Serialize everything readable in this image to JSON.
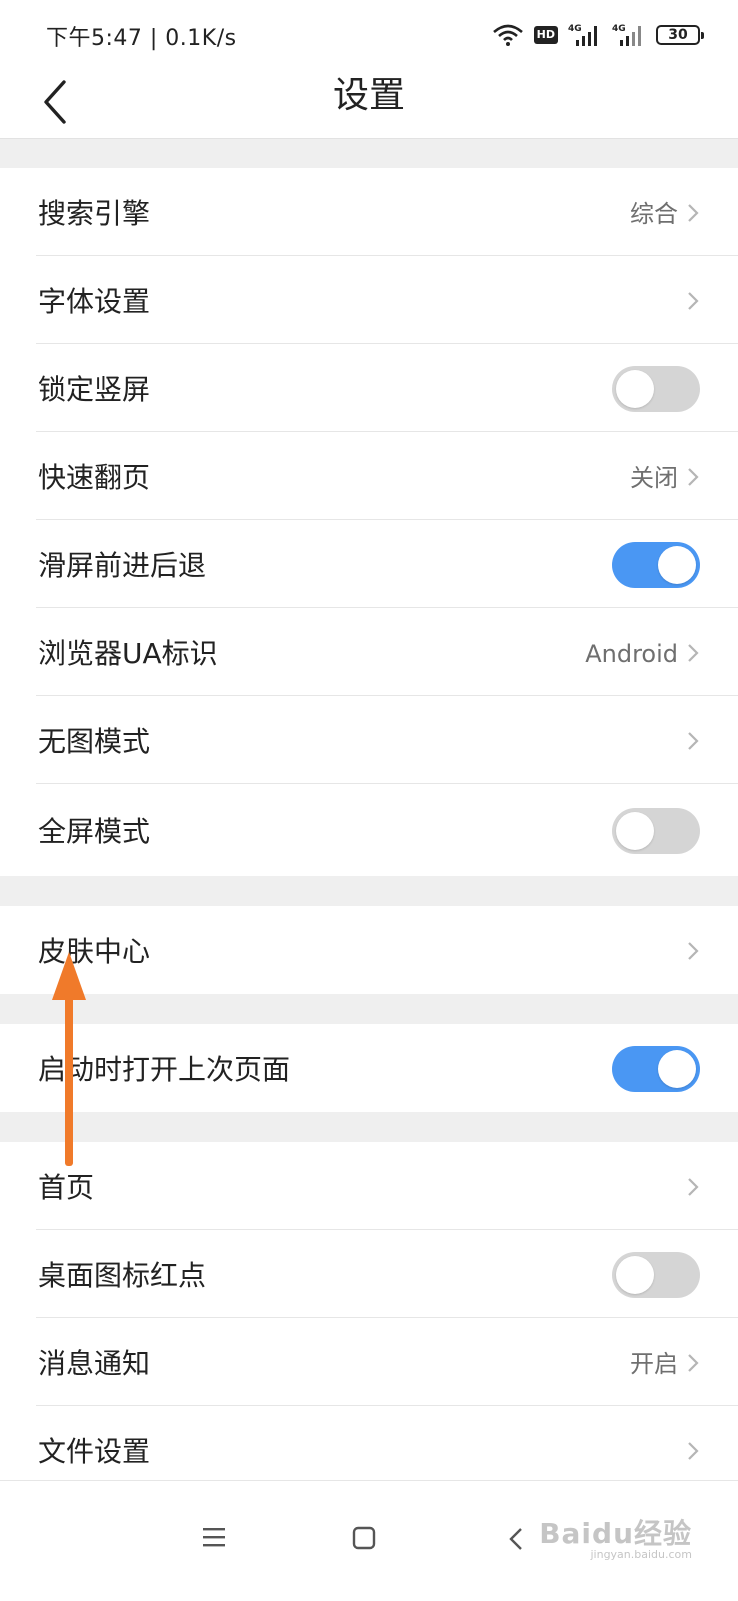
{
  "status_bar": {
    "time_speed": "下午5:47 | 0.1K/s",
    "hd_label": "HD",
    "network_1": "4G",
    "network_2": "4G",
    "battery": "30"
  },
  "header": {
    "title": "设置"
  },
  "rows": [
    {
      "label": "搜索引擎",
      "value": "综合",
      "type": "link"
    },
    {
      "label": "字体设置",
      "value": "",
      "type": "link"
    },
    {
      "label": "锁定竖屏",
      "type": "toggle",
      "on": false
    },
    {
      "label": "快速翻页",
      "value": "关闭",
      "type": "link"
    },
    {
      "label": "滑屏前进后退",
      "type": "toggle",
      "on": true
    },
    {
      "label": "浏览器UA标识",
      "value": "Android",
      "type": "link"
    },
    {
      "label": "无图模式",
      "value": "",
      "type": "link"
    },
    {
      "label": "全屏模式",
      "type": "toggle",
      "on": false
    },
    {
      "label": "皮肤中心",
      "value": "",
      "type": "link"
    },
    {
      "label": "启动时打开上次页面",
      "type": "toggle",
      "on": true
    },
    {
      "label": "首页",
      "value": "",
      "type": "link"
    },
    {
      "label": "桌面图标红点",
      "type": "toggle",
      "on": false
    },
    {
      "label": "消息通知",
      "value": "开启",
      "type": "link"
    },
    {
      "label": "文件设置",
      "value": "",
      "type": "link"
    }
  ],
  "watermark": {
    "text": "Baidu经验",
    "sub": "jingyan.baidu.com"
  },
  "colors": {
    "toggle_on": "#4a97f3",
    "toggle_off": "#d5d5d5",
    "section_gap": "#efefef",
    "annotation_arrow": "#f07a2a"
  }
}
